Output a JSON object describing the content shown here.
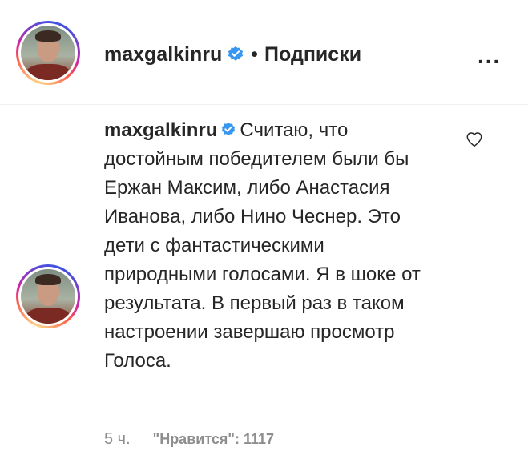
{
  "header": {
    "username": "maxgalkinru",
    "separator": "•",
    "follow_label": "Подписки",
    "more_label": "..."
  },
  "comment": {
    "username": "maxgalkinru",
    "text": "Считаю, что достойным победителем были бы Ержан Максим, либо Анастасия Иванова, либо Нино Чеснер. Это дети с фантастическими природными голосами. Я в шоке от результата. В первый раз в таком настроении завершаю просмотр Голоса.",
    "time": "5 ч.",
    "likes": "\"Нравится\": 1117"
  },
  "icons": {
    "verified": "verified-badge-icon",
    "like": "heart-icon",
    "more": "more-options-icon"
  },
  "colors": {
    "verified_blue": "#3897f0",
    "text": "#262626",
    "secondary": "#8e8e8e"
  }
}
